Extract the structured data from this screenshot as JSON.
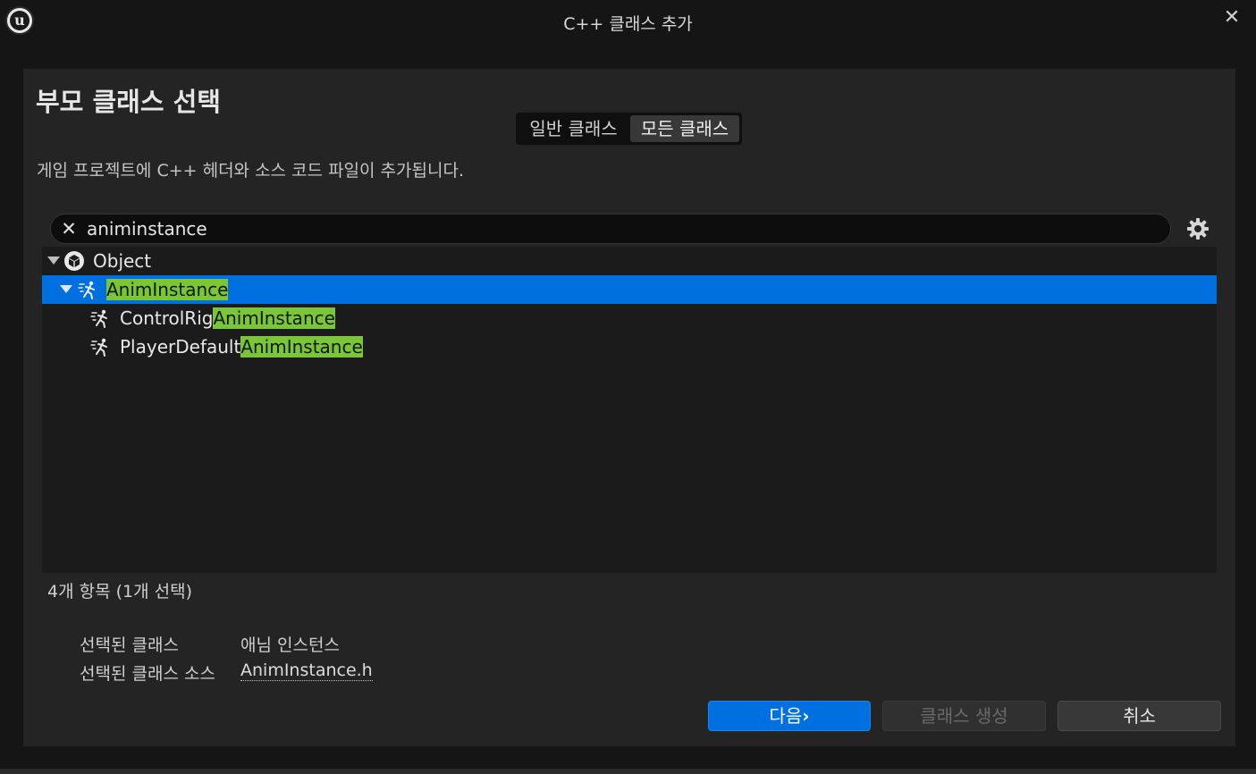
{
  "window": {
    "title": "C++ 클래스 추가"
  },
  "heading": "부모 클래스 선택",
  "segment": {
    "basic_label": "일반 클래스",
    "all_label": "모든 클래스",
    "active": "all"
  },
  "description": "게임 프로젝트에 C++ 헤더와 소스 코드 파일이 추가됩니다.",
  "search": {
    "value": "animinstance"
  },
  "tree": {
    "rows": [
      {
        "prefix": "Object",
        "match": "",
        "icon": "object-icon",
        "expanded": true,
        "selected": false,
        "depth": 0
      },
      {
        "prefix": "",
        "match": "AnimInstance",
        "icon": "anim-instance-icon",
        "expanded": true,
        "selected": true,
        "depth": 1
      },
      {
        "prefix": "ControlRig",
        "match": "AnimInstance",
        "icon": "anim-instance-icon",
        "expanded": false,
        "selected": false,
        "depth": 2
      },
      {
        "prefix": "PlayerDefault",
        "match": "AnimInstance",
        "icon": "anim-instance-icon",
        "expanded": false,
        "selected": false,
        "depth": 2
      }
    ]
  },
  "status": {
    "count_text": "4개 항목 (1개 선택)"
  },
  "selected_info": {
    "class_label": "선택된 클래스",
    "class_value": "애님 인스턴스",
    "source_label": "선택된 클래스 소스",
    "source_value": "AnimInstance.h"
  },
  "buttons": {
    "next": "다음",
    "create": "클래스 생성",
    "cancel": "취소"
  },
  "colors": {
    "accent": "#0070e0",
    "highlight": "#7cc43a",
    "panel": "#242424",
    "background": "#151515"
  }
}
